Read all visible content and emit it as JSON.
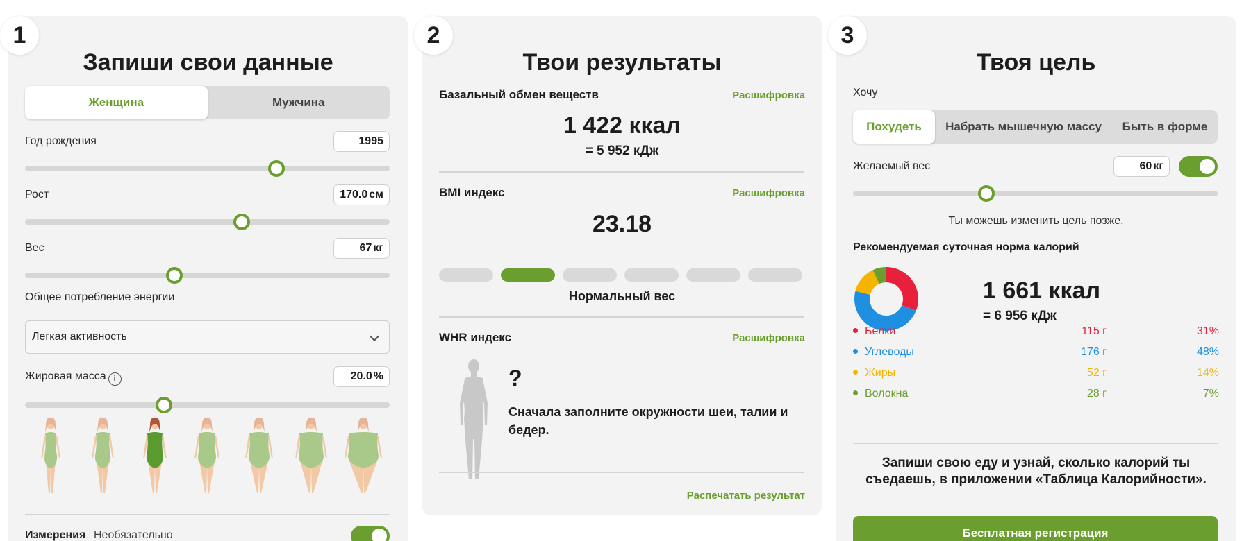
{
  "panel1": {
    "step": "1",
    "title": "Запиши свои данные",
    "gender": {
      "female": "Женщина",
      "male": "Мужчина"
    },
    "birth_year": {
      "label": "Год рождения",
      "value": "1995",
      "slider_fraction": 0.69
    },
    "height": {
      "label": "Рост",
      "value": "170.0",
      "unit": "см",
      "slider_fraction": 0.595
    },
    "weight": {
      "label": "Вес",
      "value": "67",
      "unit": "кг",
      "slider_fraction": 0.41
    },
    "energy": {
      "label": "Общее потребление энергии",
      "value": "Легкая активность"
    },
    "fat": {
      "label": "Жировая масса",
      "value": "20.0",
      "unit": "%",
      "slider_fraction": 0.38
    },
    "body_types": [
      "very-slim",
      "slim",
      "selected-normal",
      "average",
      "curvy",
      "plump",
      "heavy"
    ],
    "measurements": {
      "label": "Измерения",
      "hint": "Необязательно"
    }
  },
  "panel2": {
    "step": "2",
    "title": "Твои результаты",
    "bmr": {
      "label": "Базальный обмен веществ",
      "link": "Расшифровка",
      "kcal": "1 422 ккал",
      "kj": "= 5 952 кДж"
    },
    "bmi": {
      "label": "BMI индекс",
      "link": "Расшифровка",
      "value": "23.18",
      "active_segment": 1,
      "status": "Нормальный вес"
    },
    "whr": {
      "label": "WHR индекс",
      "link": "Расшифровка",
      "mark": "?",
      "text": "Сначала заполните окружности шеи, талии и бедер."
    },
    "print": "Распечатать результат"
  },
  "panel3": {
    "step": "3",
    "title": "Твоя цель",
    "want_label": "Хочу",
    "goals": [
      "Похудеть",
      "Набрать мышечную массу",
      "Быть в форме"
    ],
    "desired_weight": {
      "label": "Желаемый вес",
      "value": "60",
      "unit": "кг",
      "slider_fraction": 0.365
    },
    "note": "Ты можешь изменить цель позже.",
    "rec_title": "Рекомендуемая суточная норма калорий",
    "kcal": "1 661 ккал",
    "kj": "= 6 956 кДж",
    "macros": [
      {
        "name": "Белки",
        "grams": "115 г",
        "pct": "31%",
        "percent": 31,
        "color": "#e8203c"
      },
      {
        "name": "Углеводы",
        "grams": "176 г",
        "pct": "48%",
        "percent": 48,
        "color": "#1e8fe1"
      },
      {
        "name": "Жиры",
        "grams": "52 г",
        "pct": "14%",
        "percent": 14,
        "color": "#f5b400"
      },
      {
        "name": "Волокна",
        "grams": "28 г",
        "pct": "7%",
        "percent": 7,
        "color": "#6a9f2f"
      }
    ],
    "cta_text": "Запиши свою еду и узнай, сколько калорий ты съедаешь, в приложении «Таблица Калорийности».",
    "register": "Бесплатная регистрация"
  },
  "colors": {
    "accent": "#6a9f2f",
    "panel_bg": "#f3f3f3"
  }
}
